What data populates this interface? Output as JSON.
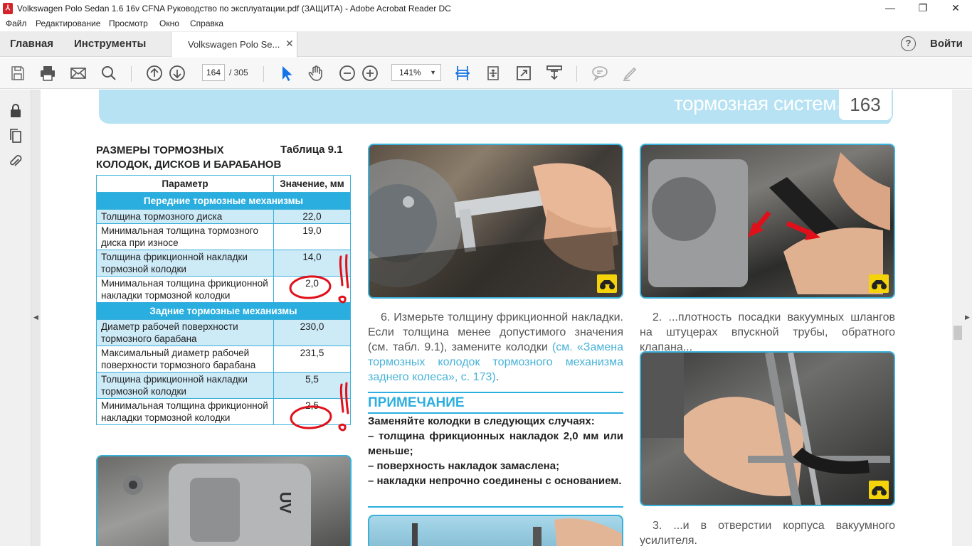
{
  "window": {
    "app_icon": "pdf-icon",
    "title": "Volkswagen Polo Sedan 1.6 16v CFNA Руководство по эксплуатации.pdf (ЗАЩИТА) - Adobe Acrobat Reader DC",
    "min": "—",
    "max": "❐",
    "close": "✕"
  },
  "menu": [
    "Файл",
    "Редактирование",
    "Просмотр",
    "Окно",
    "Справка"
  ],
  "tabs": {
    "home": "Главная",
    "tools": "Инструменты",
    "document": "Volkswagen Polo Se...",
    "close": "✕",
    "help": "?",
    "signin": "Войти"
  },
  "toolbar": {
    "page_current": "164",
    "page_total": "/ 305",
    "zoom": "141%",
    "zoom_arrow": "▼",
    "icons": [
      "save-icon",
      "print-icon",
      "email-icon",
      "search-icon",
      "page-up-icon",
      "page-down-icon",
      "select-cursor-icon",
      "hand-icon",
      "zoom-out-icon",
      "zoom-in-icon",
      "fit-width-icon",
      "rotate-icon",
      "fullscreen-icon",
      "scroll-mode-icon",
      "comment-icon",
      "highlight-pen-icon"
    ]
  },
  "left_pane": {
    "icons": [
      "lock-icon",
      "pages-icon",
      "attachment-icon"
    ],
    "collapse": "◀"
  },
  "right_pane": {
    "collapse": "▶"
  },
  "page": {
    "section": "тормозная система",
    "number": "163",
    "table": {
      "title_line1": "РАЗМЕРЫ ТОРМОЗНЫХ",
      "title_line2": "КОЛОДОК, ДИСКОВ И БАРАБАНОВ",
      "number": "Таблица 9.1",
      "col_param": "Параметр",
      "col_value": "Значение, мм",
      "front_header": "Передние тормозные механизмы",
      "front_rows": [
        {
          "param": "Толщина тормозного диска",
          "value": "22,0"
        },
        {
          "param": "Минимальная толщина тормозного диска при износе",
          "value": "19,0"
        },
        {
          "param": "Толщина фрикционной накладки тормозной колодки",
          "value": "14,0"
        },
        {
          "param": "Минимальная толщина фрикционной накладки тормозной колодки",
          "value": "2,0"
        }
      ],
      "rear_header": "Задние тормозные механизмы",
      "rear_rows": [
        {
          "param": "Диаметр рабочей поверхности тормозного барабана",
          "value": "230,0"
        },
        {
          "param": "Максимальный диаметр рабочей поверхности тормозного барабана",
          "value": "231,5"
        },
        {
          "param": "Толщина фрикционной накладки тормозной колодки",
          "value": "5,5"
        },
        {
          "param": "Минимальная толщина фрикционной накладки тормозной колодки",
          "value": "2,5"
        }
      ]
    },
    "photo_caliper_text": "UV",
    "caption_6_text": "6. Измерьте толщину фрикционной накладки. Если толщина менее допустимого значения (см. табл. 9.1), замените колодки ",
    "caption_6_link": "(см. «Замена тормозных колодок тормозного механизма заднего колеса», с. 173)",
    "caption_6_end": ".",
    "note_title": "ПРИМЕЧАНИЕ",
    "note_lines": [
      "Заменяйте колодки в следующих случаях:",
      "– толщина фрикционных накладок 2,0 мм или меньше;",
      "– поверхность накладок замаслена;",
      "– накладки непрочно соединены с основанием."
    ],
    "caption_2": "2. ...плотность посадки вакуумных шлангов на штуцерах впускной трубы, обратного клапана...",
    "caption_3": "3. ...и в отверстии корпуса вакуумного усилителя."
  },
  "colors": {
    "accent_blue": "#2aaee0",
    "banner": "#b6e2f3",
    "annotation_red": "#e0101a",
    "badge_yellow": "#f5d30a"
  }
}
